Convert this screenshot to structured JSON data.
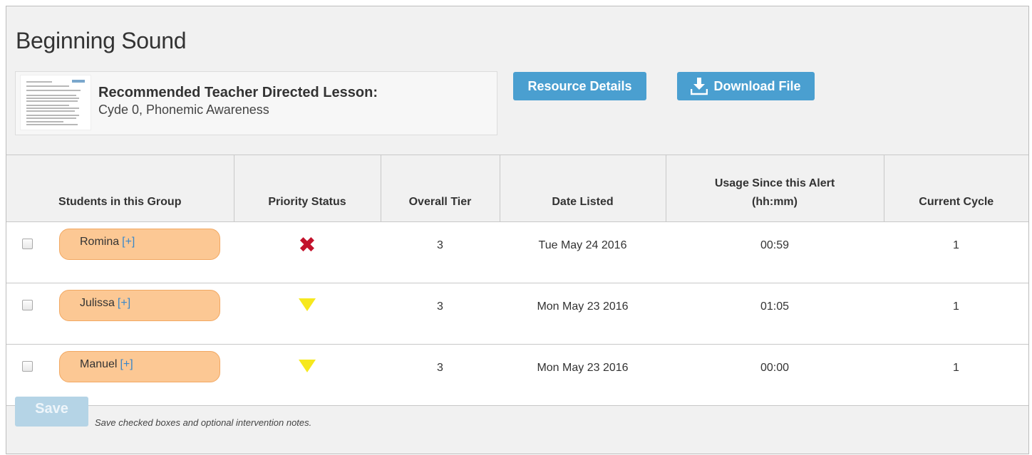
{
  "page_title": "Beginning Sound",
  "lesson": {
    "label": "Recommended Teacher Directed Lesson:",
    "value": "Cyde 0, Phonemic Awareness",
    "thumbnail_icon": "document-thumbnail"
  },
  "buttons": {
    "resource_details": "Resource Details",
    "download_file": "Download File",
    "download_icon": "download-icon",
    "save": "Save"
  },
  "table": {
    "columns": [
      {
        "line1": "Students in this Group",
        "line2": ""
      },
      {
        "line1": "Priority Status",
        "line2": ""
      },
      {
        "line1": "Overall Tier",
        "line2": ""
      },
      {
        "line1": "Date Listed",
        "line2": ""
      },
      {
        "line1": "Usage Since this Alert",
        "line2": "(hh:mm)"
      },
      {
        "line1": "Current Cycle",
        "line2": ""
      }
    ],
    "rows": [
      {
        "student": "Romina",
        "expand": "[+]",
        "priority": "x-icon",
        "tier": "3",
        "date": "Tue May 24 2016",
        "usage": "00:59",
        "cycle": "1"
      },
      {
        "student": "Julissa",
        "expand": "[+]",
        "priority": "triangle-down-icon",
        "tier": "3",
        "date": "Mon May 23 2016",
        "usage": "01:05",
        "cycle": "1"
      },
      {
        "student": "Manuel",
        "expand": "[+]",
        "priority": "triangle-down-icon",
        "tier": "3",
        "date": "Mon May 23 2016",
        "usage": "00:00",
        "cycle": "1"
      }
    ]
  },
  "footer_note": "Save checked boxes and optional intervention notes.",
  "colors": {
    "button_blue": "#4a9fd0",
    "pill_orange": "#fcc894",
    "status_red": "#c3122c",
    "status_yellow": "#f6e81e",
    "disabled_save": "#b5d4e6"
  }
}
